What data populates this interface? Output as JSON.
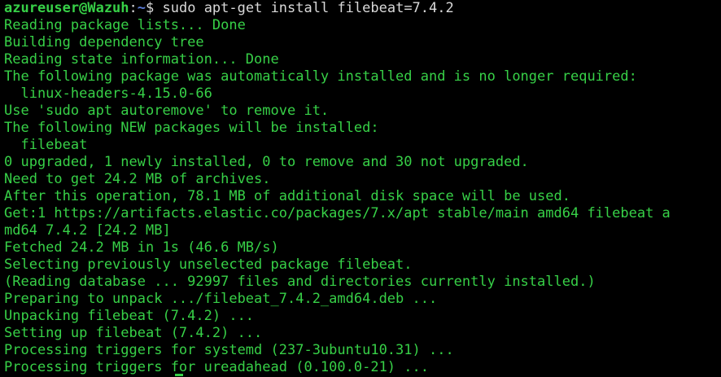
{
  "prompt": {
    "user_host": "azureuser@Wazuh",
    "separator": ":",
    "path": "~",
    "dollar": "$ ",
    "command": "sudo apt-get install filebeat=7.4.2"
  },
  "output_lines": [
    "Reading package lists... Done",
    "Building dependency tree",
    "Reading state information... Done",
    "The following package was automatically installed and is no longer required:",
    "  linux-headers-4.15.0-66",
    "Use 'sudo apt autoremove' to remove it.",
    "The following NEW packages will be installed:",
    "  filebeat",
    "0 upgraded, 1 newly installed, 0 to remove and 30 not upgraded.",
    "Need to get 24.2 MB of archives.",
    "After this operation, 78.1 MB of additional disk space will be used.",
    "Get:1 https://artifacts.elastic.co/packages/7.x/apt stable/main amd64 filebeat a",
    "md64 7.4.2 [24.2 MB]",
    "Fetched 24.2 MB in 1s (46.6 MB/s)",
    "Selecting previously unselected package filebeat.",
    "(Reading database ... 92997 files and directories currently installed.)",
    "Preparing to unpack .../filebeat_7.4.2_amd64.deb ...",
    "Unpacking filebeat (7.4.2) ...",
    "Setting up filebeat (7.4.2) ...",
    "Processing triggers for systemd (237-3ubuntu10.31) ...",
    "Processing triggers for ureadahead (0.100.0-21) ..."
  ],
  "colors": {
    "background": "#000000",
    "output_text": "#37d047",
    "command_text": "#d9d9d9",
    "path": "#5b7bd6"
  }
}
